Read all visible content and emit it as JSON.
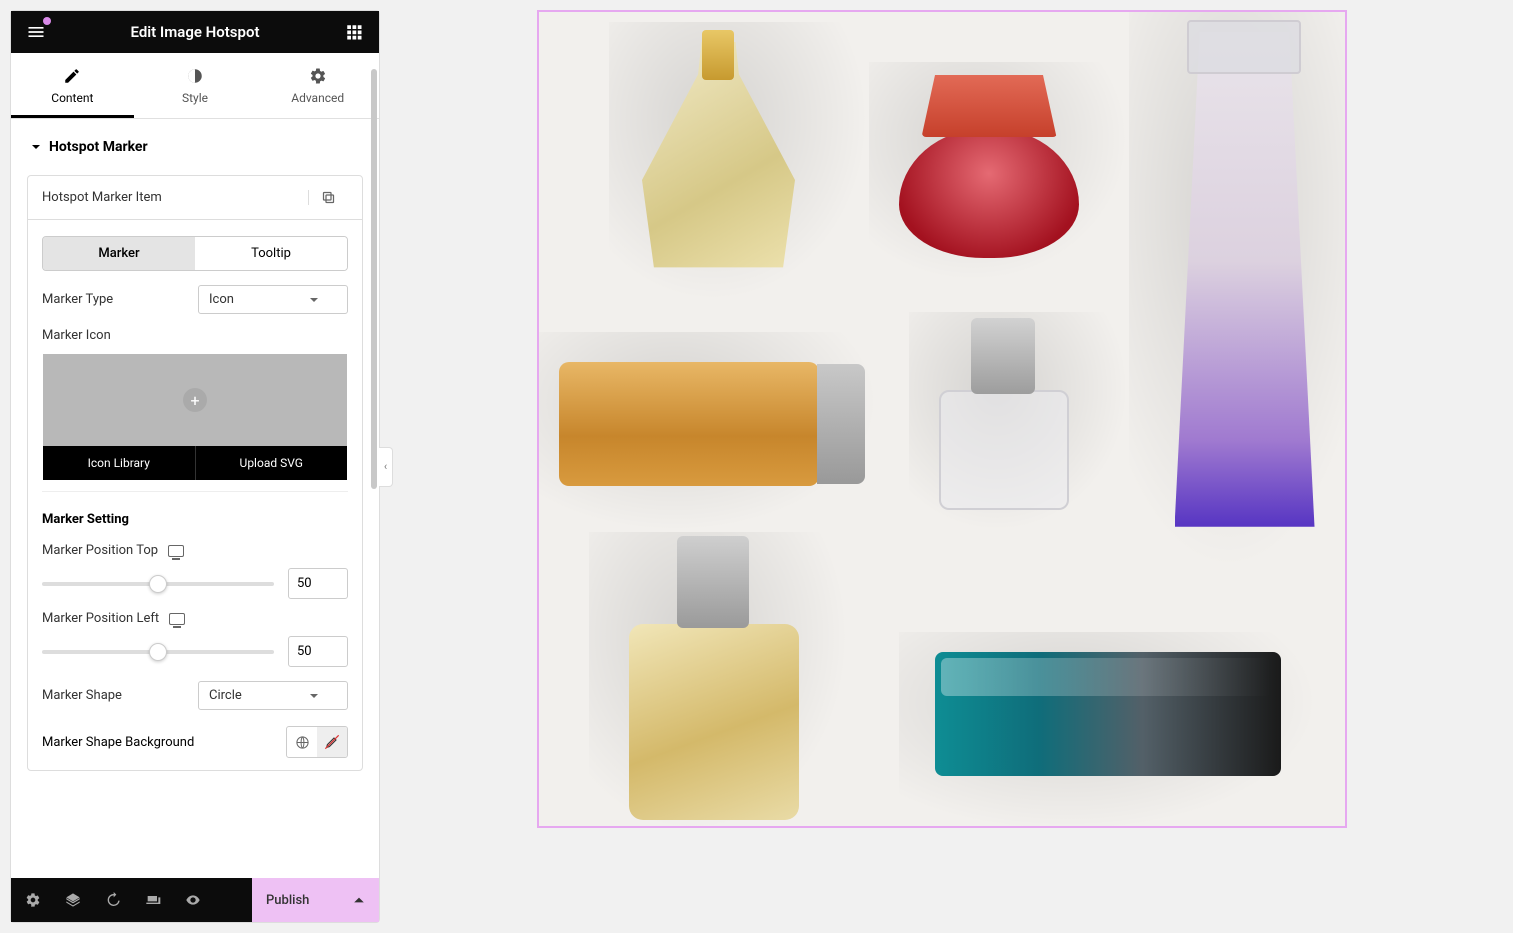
{
  "header": {
    "title": "Edit Image Hotspot"
  },
  "tabs": {
    "content": "Content",
    "style": "Style",
    "advanced": "Advanced",
    "active": "content"
  },
  "section": {
    "title": "Hotspot Marker"
  },
  "item": {
    "title": "Hotspot Marker Item"
  },
  "subtabs": {
    "marker": "Marker",
    "tooltip": "Tooltip",
    "active": "marker"
  },
  "markerType": {
    "label": "Marker Type",
    "value": "Icon"
  },
  "markerIcon": {
    "label": "Marker Icon",
    "library": "Icon Library",
    "upload": "Upload SVG"
  },
  "markerSetting": {
    "heading": "Marker Setting",
    "posTop": {
      "label": "Marker Position Top",
      "value": "50"
    },
    "posLeft": {
      "label": "Marker Position Left",
      "value": "50"
    },
    "shape": {
      "label": "Marker Shape",
      "value": "Circle"
    },
    "bg": {
      "label": "Marker Shape Background"
    }
  },
  "footer": {
    "publish": "Publish"
  }
}
